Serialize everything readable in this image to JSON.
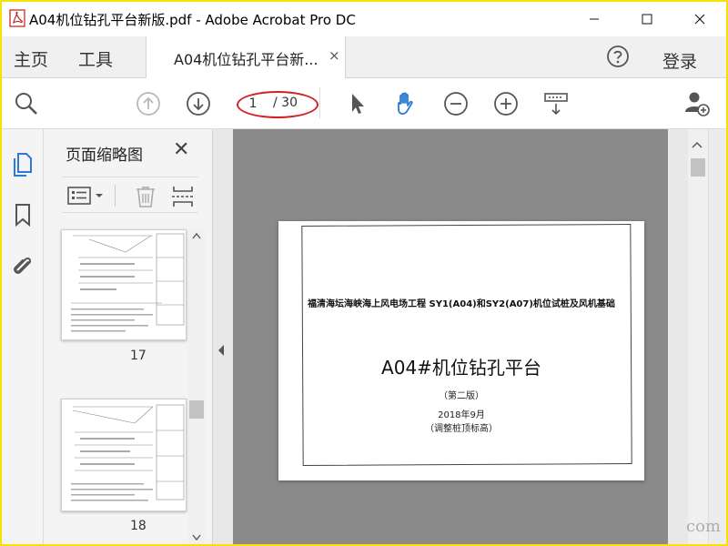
{
  "window": {
    "title": "A04机位钻孔平台新版.pdf - Adobe Acrobat Pro DC"
  },
  "menu": {
    "home": "主页",
    "tools": "工具",
    "tab_label": "A04机位钻孔平台新...",
    "tab_close": "×",
    "login": "登录"
  },
  "toolbar": {
    "current_page": "1",
    "total_pages": "/ 30"
  },
  "thumbnails": {
    "title": "页面缩略图",
    "close": "✕",
    "items": [
      {
        "page": "17"
      },
      {
        "page": "18"
      }
    ]
  },
  "document": {
    "header": "福清海坛海峡海上风电场工程 SY1(A04)和SY2(A07)机位试桩及风机基础",
    "title": "A04#机位钻孔平台",
    "edition": "（第二版）",
    "date": "2018年9月",
    "note": "（调整桩顶标高）"
  },
  "watermark": "com",
  "colors": {
    "accent_blue": "#2a7ad6",
    "annotation_red": "#d32020",
    "frame_yellow": "#f5e400",
    "canvas_gray": "#8a8a8a"
  },
  "icons": {
    "zoom": "magnifier-icon",
    "prev": "arrow-up-circle-icon",
    "next": "arrow-down-circle-icon",
    "select": "cursor-arrow-icon",
    "hand": "hand-icon",
    "zoom_out": "minus-circle-icon",
    "zoom_in": "plus-circle-icon",
    "fit": "fit-page-icon",
    "share": "add-user-icon"
  }
}
